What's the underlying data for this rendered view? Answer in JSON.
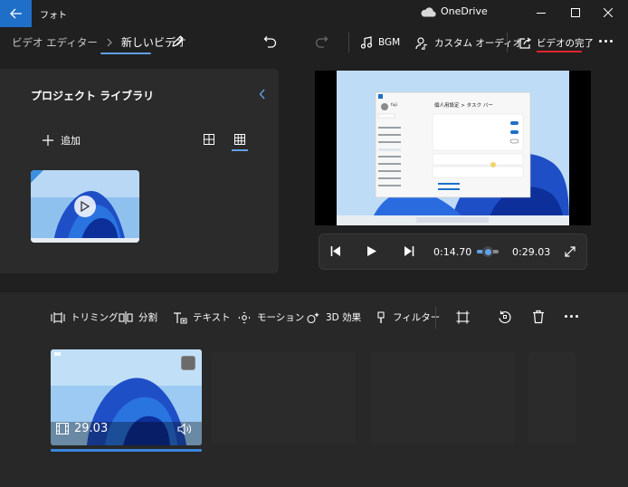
{
  "window": {
    "app_title": "フォト",
    "onedrive_label": "OneDrive"
  },
  "nav": {
    "breadcrumb_parent": "ビデオ エディター",
    "breadcrumb_current": "新しいビデオ",
    "bgm_label": "BGM",
    "custom_audio_label": "カスタム オーディオ",
    "finish_video_label": "ビデオの完了"
  },
  "library": {
    "title": "プロジェクト ライブラリ",
    "add_label": "追加"
  },
  "player": {
    "current_time": "0:14.70",
    "total_time": "0:29.03",
    "progress": 0.506
  },
  "toolbar": {
    "trim_label": "トリミング",
    "split_label": "分割",
    "text_label": "テキスト",
    "motion_label": "モーション",
    "effects_label": "3D 効果",
    "filter_label": "フィルター"
  },
  "storyboard": {
    "clips": [
      {
        "duration": "29.03"
      }
    ]
  },
  "preview_screen": {
    "settings_heading": "個人用設定 > タスク バー",
    "user_name": "fuji"
  },
  "colors": {
    "accent": "#60a0e8",
    "finish_underline": "#e0242b",
    "window_bg": "#202020",
    "panel_bg": "#2b2b2b"
  }
}
